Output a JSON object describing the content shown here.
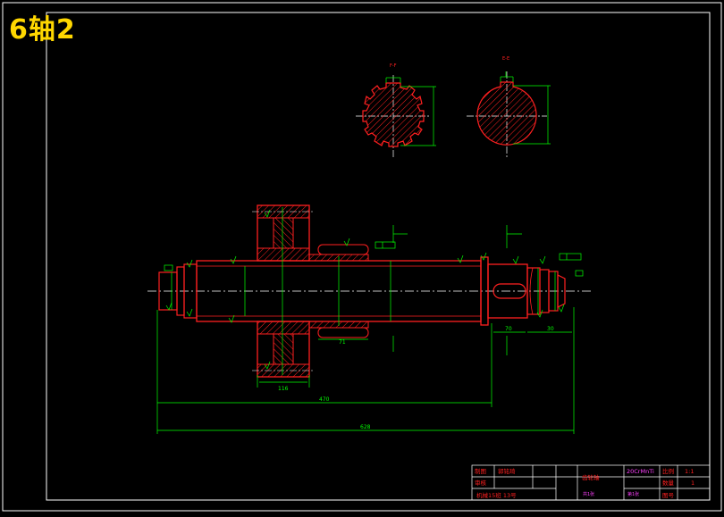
{
  "drawing": {
    "title": "6轴2"
  },
  "sections": {
    "left_label": "F-F",
    "right_label": "E-E"
  },
  "dimensions": {
    "overall_length": "628",
    "main_length": "470",
    "gear_width": "116",
    "key_length": "71",
    "end_length": "70",
    "tip_length": "30"
  },
  "title_block": {
    "row1_label": "制图",
    "row1_name": "郭铭琦",
    "row2_label": "审核",
    "part_name": "齿轮轴",
    "material": "20CrMnTi",
    "scale_label": "比例",
    "scale_value": "1:1",
    "qty_label": "数量",
    "qty_value": "1",
    "class_info": "机械15班 13号",
    "red_a": "共1张",
    "red_b": "第1张",
    "drawing_no_label": "图号"
  },
  "colors": {
    "border": "#ffffff",
    "outline": "#ff2020",
    "dimension": "#00ff00",
    "centerline": "#ffffff",
    "hatch": "#ff2020",
    "title": "#ffd700",
    "tb_text": "#ff2020",
    "tb_text2": "#ff40ff"
  }
}
